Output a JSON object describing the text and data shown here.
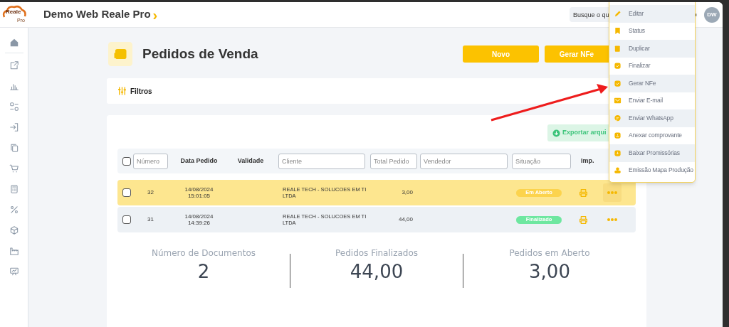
{
  "app": {
    "logo_text": "Reale",
    "logo_sub": "Pro",
    "title": "Demo Web Reale Pro",
    "title_chevron": "›"
  },
  "search": {
    "placeholder": "Busque o qu"
  },
  "user": {
    "initials": "DW"
  },
  "page": {
    "title": "Pedidos de Venda",
    "buttons": [
      "Novo",
      "Gerar NFe"
    ],
    "filters_label": "Filtros",
    "export_label": "Exportar arqui"
  },
  "table": {
    "select_all_checked": false,
    "columns": [
      {
        "kind": "filter",
        "placeholder": "Número"
      },
      {
        "kind": "header",
        "label": "Data Pedido"
      },
      {
        "kind": "header",
        "label": "Validade"
      },
      {
        "kind": "filter",
        "placeholder": "Cliente"
      },
      {
        "kind": "filter",
        "placeholder": "Total Pedido"
      },
      {
        "kind": "filter",
        "placeholder": "Vendedor"
      },
      {
        "kind": "filter",
        "placeholder": "Situação"
      },
      {
        "kind": "header",
        "label": "Imp."
      }
    ],
    "rows": [
      {
        "selected": true,
        "checked": false,
        "number": "32",
        "date": "14/08/2024",
        "time": "15:01:05",
        "client": "REALE TECH - SOLUCOES EM TI LTDA",
        "total": "3,00",
        "status": "Em Aberto",
        "color": "#fcd34d"
      },
      {
        "selected": false,
        "checked": false,
        "number": "31",
        "date": "14/08/2024",
        "time": "14:39:26",
        "client": "REALE TECH - SOLUCOES EM TI LTDA",
        "total": "44,00",
        "status": "Finalizado",
        "color": "#6ee7a0"
      }
    ]
  },
  "summary": [
    {
      "label": "Número de Documentos",
      "value": "2"
    },
    {
      "label": "Pedidos Finalizados",
      "value": "44,00"
    },
    {
      "label": "Pedidos em Aberto",
      "value": "3,00"
    }
  ],
  "action_menu": {
    "items": [
      {
        "label": "Editar"
      },
      {
        "label": "Status"
      },
      {
        "label": "Duplicar"
      },
      {
        "label": "Finalizar"
      },
      {
        "label": "Gerar NFe"
      },
      {
        "label": "Enviar E-mail"
      },
      {
        "label": "Enviar WhatsApp"
      },
      {
        "label": "Anexar comprovante"
      },
      {
        "label": "Baixar Promissórias"
      },
      {
        "label": "Emissão Mapa Produção"
      }
    ]
  }
}
